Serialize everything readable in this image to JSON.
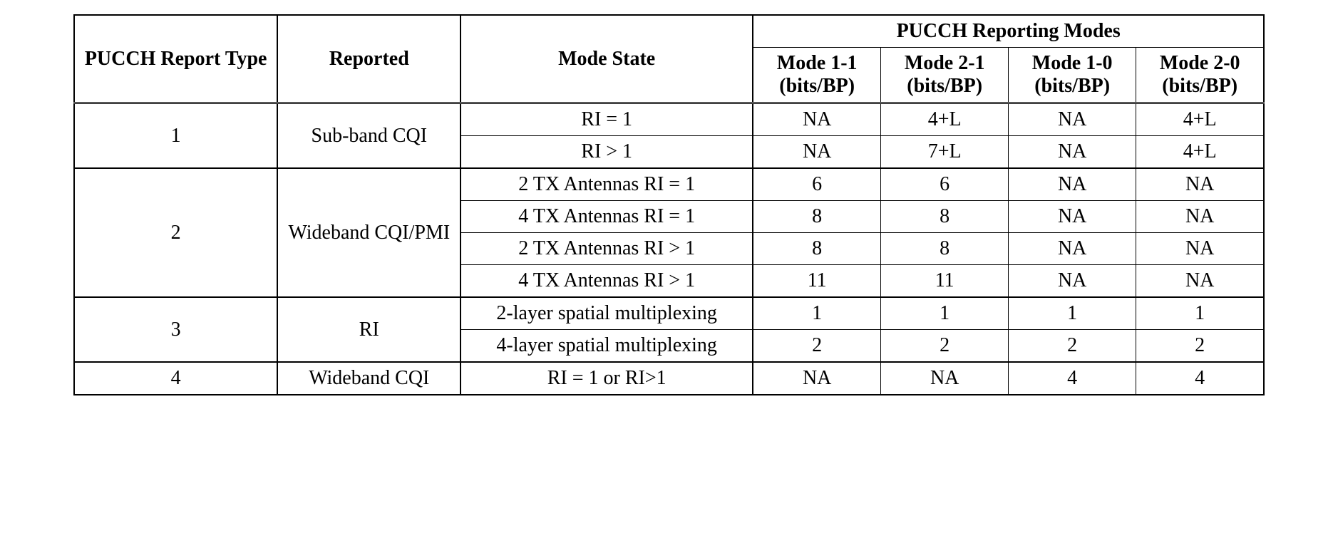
{
  "headers": {
    "type": "PUCCH Report Type",
    "reported": "Reported",
    "state": "Mode State",
    "modes_group": "PUCCH Reporting Modes",
    "m11_a": "Mode 1-1",
    "m11_b": "(bits/BP)",
    "m21_a": "Mode 2-1",
    "m21_b": "(bits/BP)",
    "m10_a": "Mode 1-0",
    "m10_b": "(bits/BP)",
    "m20_a": "Mode 2-0",
    "m20_b": "(bits/BP)"
  },
  "groups": [
    {
      "type": "1",
      "reported": "Sub-band CQI",
      "rows": [
        {
          "state": "RI = 1",
          "m11": "NA",
          "m21": "4+L",
          "m10": "NA",
          "m20": "4+L"
        },
        {
          "state": "RI > 1",
          "m11": "NA",
          "m21": "7+L",
          "m10": "NA",
          "m20": "4+L"
        }
      ]
    },
    {
      "type": "2",
      "reported": "Wideband CQI/PMI",
      "rows": [
        {
          "state": "2 TX Antennas RI = 1",
          "m11": "6",
          "m21": "6",
          "m10": "NA",
          "m20": "NA"
        },
        {
          "state": "4 TX Antennas RI = 1",
          "m11": "8",
          "m21": "8",
          "m10": "NA",
          "m20": "NA"
        },
        {
          "state": "2 TX Antennas RI > 1",
          "m11": "8",
          "m21": "8",
          "m10": "NA",
          "m20": "NA"
        },
        {
          "state": "4 TX Antennas RI > 1",
          "m11": "11",
          "m21": "11",
          "m10": "NA",
          "m20": "NA"
        }
      ]
    },
    {
      "type": "3",
      "reported": "RI",
      "rows": [
        {
          "state": "2-layer spatial multiplexing",
          "m11": "1",
          "m21": "1",
          "m10": "1",
          "m20": "1"
        },
        {
          "state": "4-layer spatial multiplexing",
          "m11": "2",
          "m21": "2",
          "m10": "2",
          "m20": "2"
        }
      ]
    },
    {
      "type": "4",
      "reported": "Wideband CQI",
      "rows": [
        {
          "state": "RI = 1 or RI>1",
          "m11": "NA",
          "m21": "NA",
          "m10": "4",
          "m20": "4"
        }
      ]
    }
  ]
}
